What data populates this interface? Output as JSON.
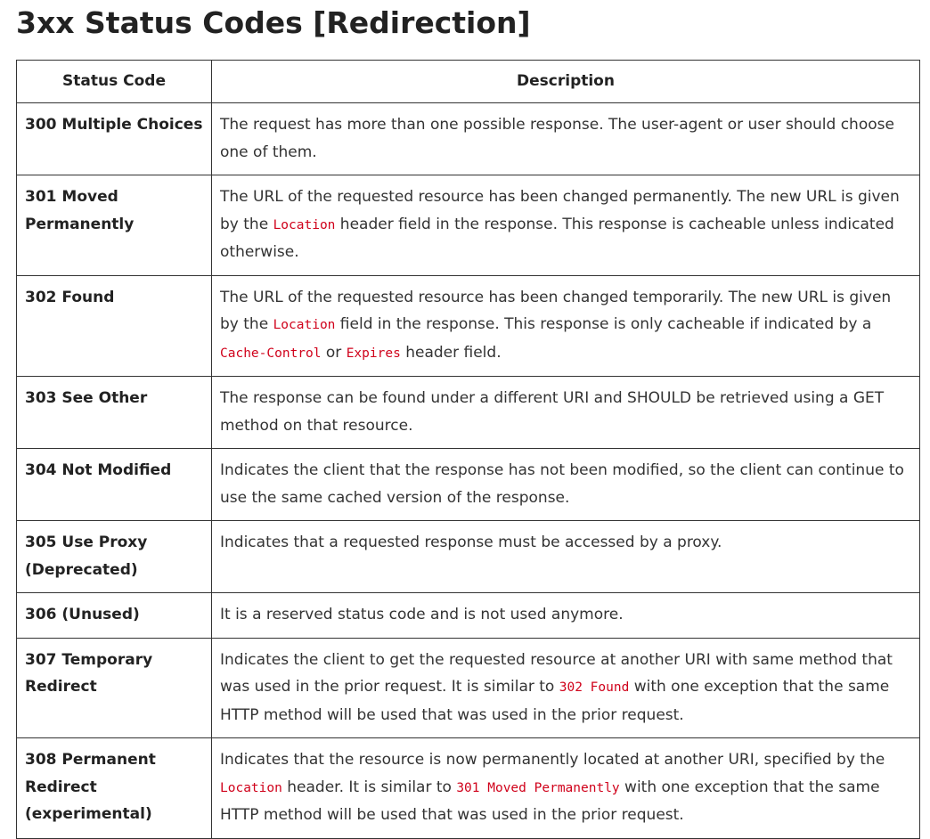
{
  "heading": "3xx Status Codes [Redirection]",
  "table": {
    "headers": [
      "Status Code",
      "Description"
    ],
    "rows": [
      {
        "code": "300 Multiple Choices",
        "desc": [
          {
            "t": "The request has more than one possible response. The user-agent or user should choose one of them."
          }
        ]
      },
      {
        "code": "301 Moved Permanently",
        "desc": [
          {
            "t": "The URL of the requested resource has been changed permanently. The new URL is given by the "
          },
          {
            "c": "Location"
          },
          {
            "t": " header field in the response. This response is cacheable unless indicated otherwise."
          }
        ]
      },
      {
        "code": "302 Found",
        "desc": [
          {
            "t": "The URL of the requested resource has been changed temporarily. The new URL is given by the "
          },
          {
            "c": "Location"
          },
          {
            "t": " field in the response. This response is only cacheable if indicated by a "
          },
          {
            "c": "Cache-Control"
          },
          {
            "t": " or "
          },
          {
            "c": "Expires"
          },
          {
            "t": " header field."
          }
        ]
      },
      {
        "code": "303 See Other",
        "desc": [
          {
            "t": "The response can be found under a different URI and SHOULD be retrieved using a GET method on that resource."
          }
        ]
      },
      {
        "code": "304 Not Modified",
        "desc": [
          {
            "t": "Indicates the client that the response has not been modified, so the client can continue to use the same cached version of the response."
          }
        ]
      },
      {
        "code": "305 Use Proxy (Deprecated)",
        "desc": [
          {
            "t": "Indicates that a requested response must be accessed by a proxy."
          }
        ]
      },
      {
        "code": "306 (Unused)",
        "desc": [
          {
            "t": "It is a reserved status code and is not used anymore."
          }
        ]
      },
      {
        "code": "307 Temporary Redirect",
        "desc": [
          {
            "t": "Indicates the client to get the requested resource at another URI with same method that was used in the prior request. It is similar to "
          },
          {
            "c": "302 Found"
          },
          {
            "t": " with one exception that the same HTTP method will be used that was used in the prior request."
          }
        ]
      },
      {
        "code": "308 Permanent Redirect (experimental)",
        "desc": [
          {
            "t": "Indicates that the resource is now permanently located at another URI, specified by the "
          },
          {
            "c": "Location"
          },
          {
            "t": " header. It is similar to "
          },
          {
            "c": "301 Moved Permanently"
          },
          {
            "t": " with one exception that the same HTTP method will be used that was used in the prior request."
          }
        ]
      }
    ]
  }
}
